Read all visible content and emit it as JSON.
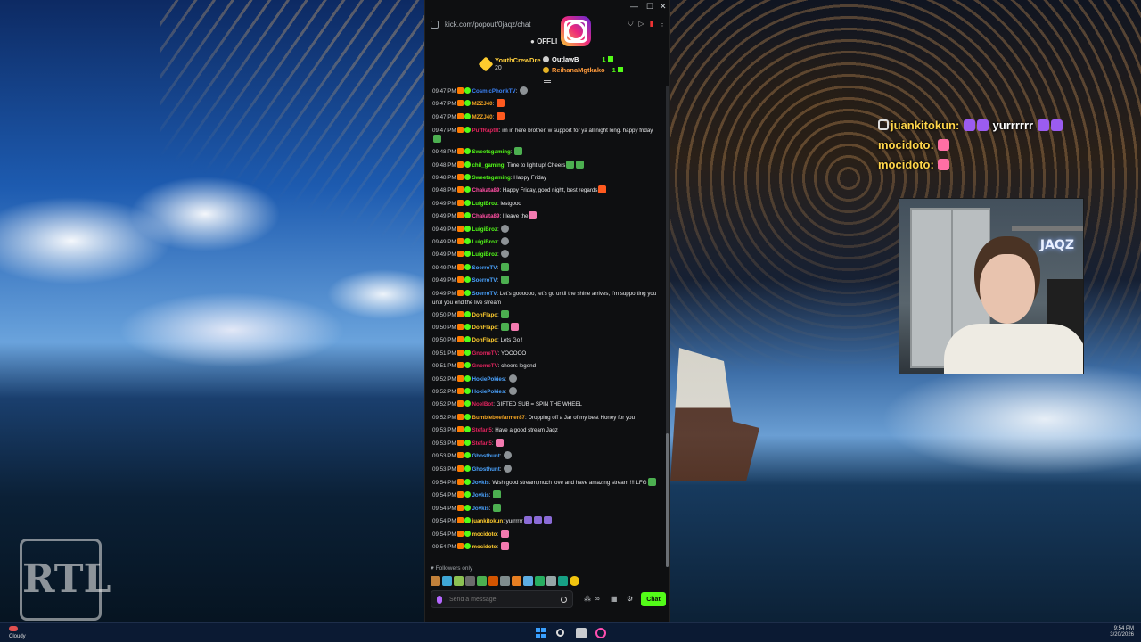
{
  "browser": {
    "url": "kick.com/popout/0jaqz/chat",
    "status": "OFFLI"
  },
  "leaderboard": {
    "top_gifter": {
      "name": "YouthCrewDre",
      "value": "20"
    },
    "entries": [
      {
        "name": "OutlawB",
        "count": "1"
      },
      {
        "name": "ReihanaMgtkako",
        "count": "1"
      }
    ]
  },
  "messages": [
    {
      "time": "09:47 PM",
      "user": "CosmicPhonkTV",
      "color": "#3b82f6",
      "text": "",
      "emotes": [
        "grey"
      ]
    },
    {
      "time": "09:47 PM",
      "user": "MZZJ40",
      "color": "#f5a623",
      "text": "",
      "emotes": [
        "fire"
      ]
    },
    {
      "time": "09:47 PM",
      "user": "MZZJ40",
      "color": "#f5a623",
      "text": "",
      "emotes": [
        "fire"
      ]
    },
    {
      "time": "09:47 PM",
      "user": "PuffRaptR",
      "color": "#e0245e",
      "text": "im in here brother. w support for ya all night long. happy friday",
      "wrap": true,
      "emotes": [
        "green"
      ]
    },
    {
      "time": "09:48 PM",
      "user": "Sweetsgaming",
      "color": "#53fc18",
      "text": "",
      "emotes": [
        "green"
      ]
    },
    {
      "time": "09:48 PM",
      "user": "chil_gaming",
      "color": "#53fc18",
      "text": "Time to light up! Cheers",
      "emotes": [
        "green",
        "green"
      ]
    },
    {
      "time": "09:48 PM",
      "user": "Sweetsgaming",
      "color": "#53fc18",
      "text": "Happy Friday",
      "emotes": []
    },
    {
      "time": "09:48 PM",
      "user": "Chakata89",
      "color": "#ff4fa3",
      "text": "Happy Friday, good night, best regards",
      "emotes": [
        "fire"
      ]
    },
    {
      "time": "09:49 PM",
      "user": "LuigiBroz",
      "color": "#53fc18",
      "text": "lestgooo",
      "emotes": []
    },
    {
      "time": "09:49 PM",
      "user": "Chakata89",
      "color": "#ff4fa3",
      "text": "I leave the",
      "emotes": [
        "pink"
      ]
    },
    {
      "time": "09:49 PM",
      "user": "LuigiBroz",
      "color": "#53fc18",
      "text": "",
      "emotes": [
        "grey"
      ]
    },
    {
      "time": "09:49 PM",
      "user": "LuigiBroz",
      "color": "#53fc18",
      "text": "",
      "emotes": [
        "grey"
      ]
    },
    {
      "time": "09:49 PM",
      "user": "LuigiBroz",
      "color": "#53fc18",
      "text": "",
      "emotes": [
        "grey"
      ]
    },
    {
      "time": "09:49 PM",
      "user": "SoerroTV",
      "color": "#4aa3ff",
      "text": "",
      "emotes": [
        "green"
      ]
    },
    {
      "time": "09:49 PM",
      "user": "SoerroTV",
      "color": "#4aa3ff",
      "text": "",
      "emotes": [
        "green"
      ]
    },
    {
      "time": "09:49 PM",
      "user": "SoerroTV",
      "color": "#4aa3ff",
      "text": "Let's goooooo, let's go until the shine arrives, I'm supporting you until you end the live stream",
      "wrap": true,
      "emotes": []
    },
    {
      "time": "09:50 PM",
      "user": "DonFlapo",
      "color": "#ffcc2e",
      "text": "",
      "emotes": [
        "green"
      ]
    },
    {
      "time": "09:50 PM",
      "user": "DonFlapo",
      "color": "#ffcc2e",
      "text": "",
      "emotes": [
        "green",
        "pink"
      ]
    },
    {
      "time": "09:50 PM",
      "user": "DonFlapo",
      "color": "#ffcc2e",
      "text": "Lets Go !",
      "emotes": []
    },
    {
      "time": "09:51 PM",
      "user": "GnomeTV",
      "color": "#e0245e",
      "text": "YOOOOO",
      "emotes": []
    },
    {
      "time": "09:51 PM",
      "user": "GnomeTV",
      "color": "#e0245e",
      "text": "cheers legend",
      "emotes": []
    },
    {
      "time": "09:52 PM",
      "user": "HokiePokies",
      "color": "#4aa3ff",
      "text": "",
      "emotes": [
        "grey"
      ]
    },
    {
      "time": "09:52 PM",
      "user": "HokiePokies",
      "color": "#4aa3ff",
      "text": "",
      "emotes": [
        "grey"
      ]
    },
    {
      "time": "09:52 PM",
      "user": "NoelBot",
      "color": "#e0245e",
      "text": "GIFTED SUB = SPIN THE WHEEL",
      "emotes": []
    },
    {
      "time": "09:52 PM",
      "user": "Bumblebeefarmer87",
      "color": "#f5a623",
      "text": "Dropping off a Jar of my best Honey for you",
      "emotes": []
    },
    {
      "time": "09:53 PM",
      "user": "Stefan5",
      "color": "#e0245e",
      "text": "Have a good stream Jaqz",
      "emotes": []
    },
    {
      "time": "09:53 PM",
      "user": "Stefan5",
      "color": "#e0245e",
      "text": "",
      "emotes": [
        "pink"
      ]
    },
    {
      "time": "09:53 PM",
      "user": "Ghosthunt",
      "color": "#4aa3ff",
      "text": "",
      "emotes": [
        "grey"
      ]
    },
    {
      "time": "09:53 PM",
      "user": "Ghosthunt",
      "color": "#4aa3ff",
      "text": "",
      "emotes": [
        "grey"
      ]
    },
    {
      "time": "09:54 PM",
      "user": "Jovkis",
      "color": "#4aa3ff",
      "text": "Wish good stream,much love and have amazing stream !!! LFG",
      "wrap": true,
      "emotes": [
        "green"
      ]
    },
    {
      "time": "09:54 PM",
      "user": "Jovkis",
      "color": "#4aa3ff",
      "text": "",
      "emotes": [
        "green"
      ]
    },
    {
      "time": "09:54 PM",
      "user": "Jovkis",
      "color": "#4aa3ff",
      "text": "",
      "emotes": [
        "green"
      ]
    },
    {
      "time": "09:54 PM",
      "user": "juankitokun",
      "color": "#ffcc2e",
      "text": "yurrrrrr",
      "emotes": [
        "",
        "",
        ""
      ]
    },
    {
      "time": "09:54 PM",
      "user": "mocidoto",
      "color": "#ffcc2e",
      "text": "",
      "emotes": [
        "pink"
      ]
    },
    {
      "time": "09:54 PM",
      "user": "mocidoto",
      "color": "#ffcc2e",
      "text": "",
      "emotes": [
        "pink"
      ]
    }
  ],
  "chat_footer": {
    "followers_label": "Followers only",
    "input_placeholder": "Send a message",
    "send_label": "Chat"
  },
  "overlay_chat": [
    {
      "user": "juankitokun:",
      "text": "yurrrrrr"
    },
    {
      "user": "mocidoto:",
      "text": ""
    },
    {
      "user": "mocidoto:",
      "text": ""
    }
  ],
  "webcam": {
    "logo_text": "JAQZ"
  },
  "watermark": {
    "text": "RTL"
  },
  "taskbar": {
    "weather": "Cloudy",
    "time": "9:54 PM",
    "date": "3/20/2026"
  }
}
